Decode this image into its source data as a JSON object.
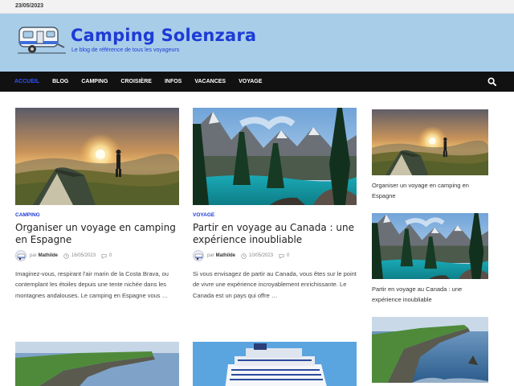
{
  "topbar": {
    "date": "23/05/2023"
  },
  "header": {
    "title": "Camping Solenzara",
    "tagline": "Le blog de référence de tous les voyageurs",
    "logo_icon": "caravan-icon"
  },
  "nav": {
    "items": [
      "ACCUEIL",
      "BLOG",
      "CAMPING",
      "CROISIÈRE",
      "INFOS",
      "VACANCES",
      "VOYAGE"
    ],
    "active": "ACCUEIL",
    "search_icon": "search-icon"
  },
  "colors": {
    "accent": "#1d3bd6",
    "header_bg": "#a8cde9",
    "nav_bg": "#111111",
    "nav_active": "#2f52ff"
  },
  "posts": [
    {
      "category": "CAMPING",
      "title": "Organiser un voyage en camping en Espagne",
      "by": "par",
      "author": "Mathilde",
      "date": "16/05/2023",
      "comments": "0",
      "excerpt": "Imaginez-vous, respirant l’air marin de la Costa Brava, ou contemplant les étoiles depuis une tente nichée dans les montagnes andalouses. Le camping en Espagne vous …",
      "image": "tent-sunset-image"
    },
    {
      "category": "VOYAGE",
      "title": "Partir en voyage au Canada : une expérience inoubliable",
      "by": "par",
      "author": "Mathilde",
      "date": "10/05/2023",
      "comments": "0",
      "excerpt": "Si vous envisagez de partir au Canada, vous êtes sur le point de vivre une expérience incroyablement enrichissante. Le Canada est un pays qui offre …",
      "image": "canada-lake-image"
    }
  ],
  "sidebar": [
    {
      "title": "Organiser un voyage en camping en Espagne",
      "image": "tent-sunset-image"
    },
    {
      "title": "Partir en voyage au Canada : une expérience inoubliable",
      "image": "canada-lake-image"
    },
    {
      "title": "",
      "image": "cliffs-coast-image"
    }
  ]
}
